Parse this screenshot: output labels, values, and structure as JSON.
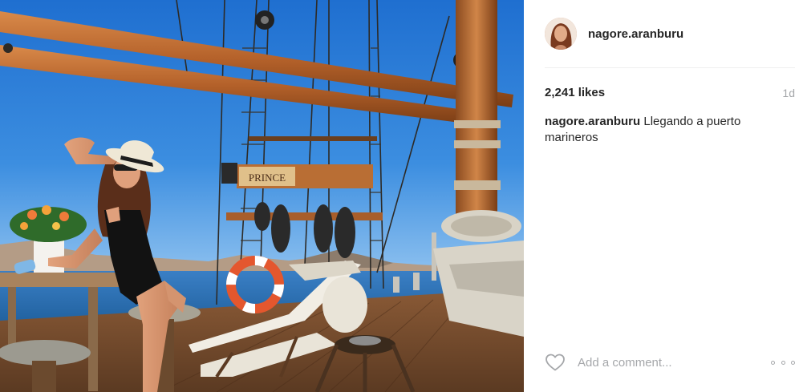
{
  "post": {
    "author": {
      "username": "nagore.aranburu"
    },
    "likes_text": "2,241 likes",
    "age": "1d",
    "caption": {
      "username": "nagore.aranburu",
      "text": "Llegando a puerto marineros"
    },
    "photo": {
      "sign_text": "PRINCE"
    },
    "comment": {
      "placeholder": "Add a comment..."
    },
    "icons": {
      "like": "heart-outline-icon",
      "more": "more-options-icon"
    },
    "colors": {
      "text": "#262626",
      "muted": "#a5a7aa",
      "divider": "#efefef",
      "sky": "#2f7fd6",
      "wood": "#b4612a"
    }
  }
}
